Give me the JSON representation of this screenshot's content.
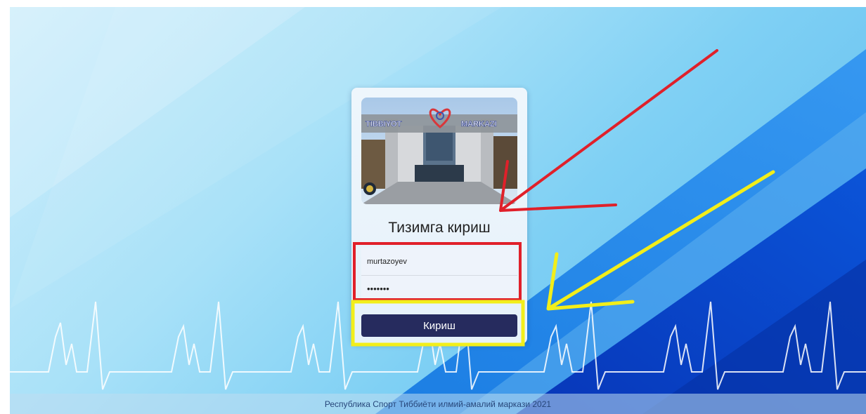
{
  "login": {
    "title": "Тизимга кириш",
    "username_value": "murtazoyev",
    "password_value": "secret1",
    "submit_label": "Кириш"
  },
  "photo": {
    "sign_left": "TIBBIYOT",
    "sign_right": "MARKAZI"
  },
  "footer": {
    "text": "Республика Спорт Тиббиёти илмий-амалий маркази 2021"
  },
  "colors": {
    "button": "#262b5e",
    "annotation_red": "#e0202a",
    "annotation_yellow": "#f2ee1a",
    "background_blue": "#0a57d6"
  }
}
